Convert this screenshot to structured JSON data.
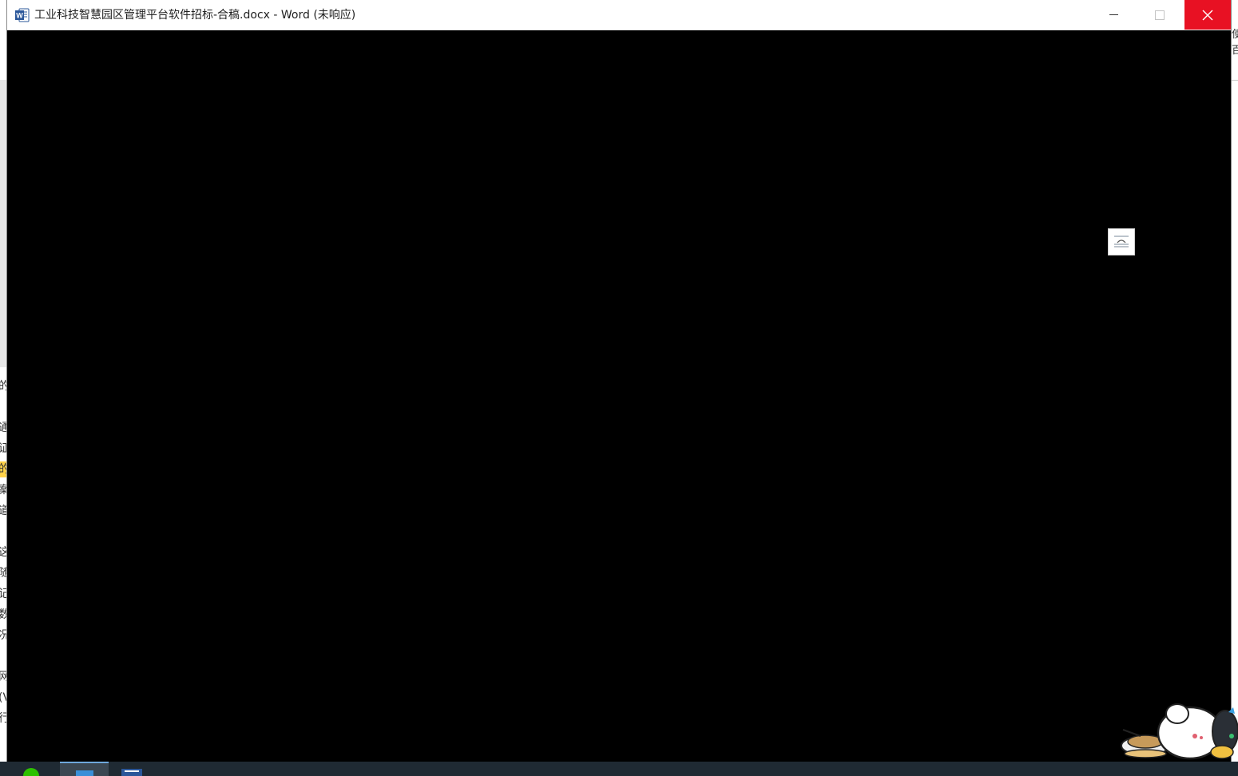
{
  "window": {
    "title": "工业科技智慧园区管理平台软件招标-合稿.docx - Word (未响应)",
    "app_icon": "word-icon",
    "controls": {
      "minimize_icon": "minimize-icon",
      "maximize_icon": "maximize-icon",
      "close_icon": "close-icon"
    }
  },
  "background_document": {
    "left_glyphs": [
      "的",
      "通",
      "证",
      "的",
      "案",
      "道",
      "这",
      "随",
      "记",
      "数",
      "况",
      "网",
      "(V",
      "行"
    ],
    "right_glyphs": [
      "使",
      "百"
    ]
  },
  "overlay": {
    "float_icon": "reading-mode-icon",
    "mascot": "cartoon-mascot"
  },
  "taskbar": {
    "items": [
      "wechat-icon",
      "file-explorer-icon",
      "word-taskbar-icon"
    ]
  },
  "colors": {
    "close_button": "#e81123",
    "word_blue": "#2b579a",
    "client_area": "#000000",
    "taskbar": "#1f2a33"
  }
}
